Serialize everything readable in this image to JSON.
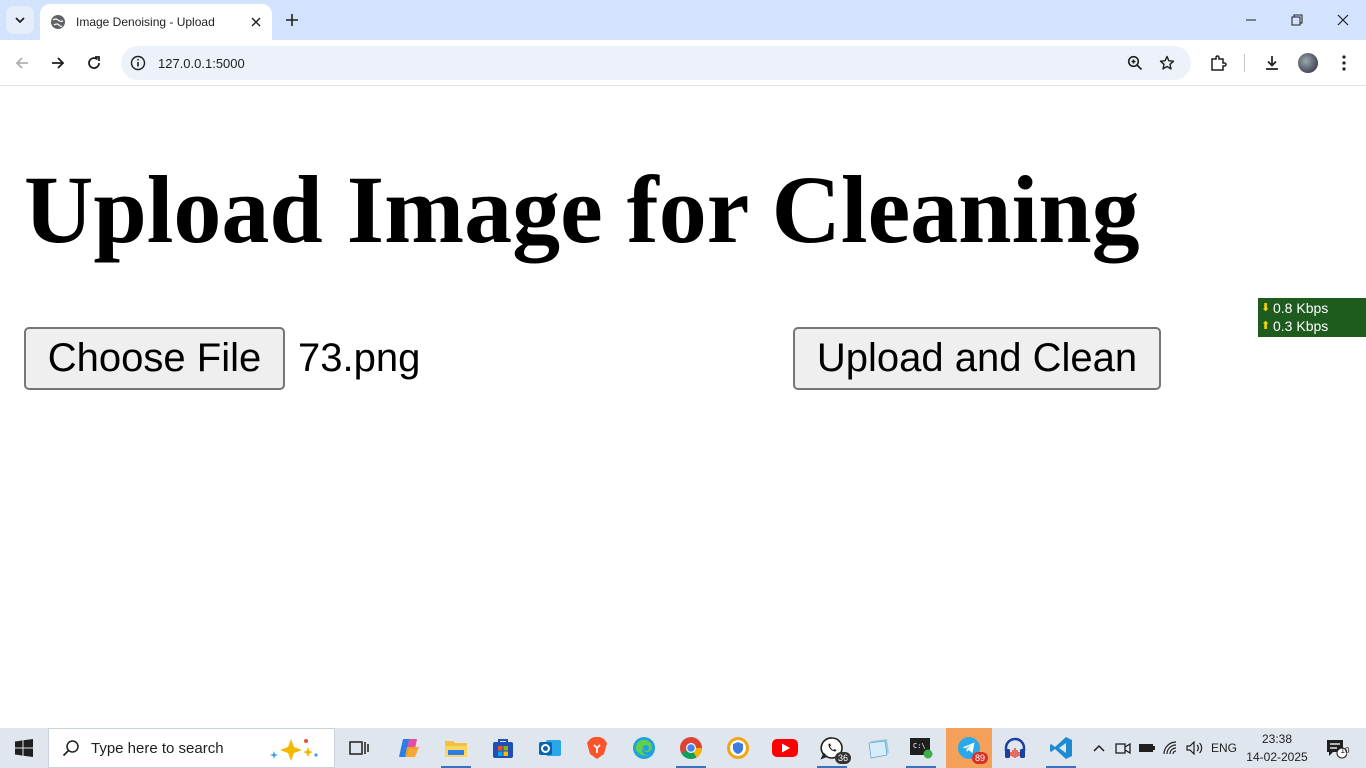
{
  "browser": {
    "tab_title": "Image Denoising - Upload",
    "url": "127.0.0.1:5000"
  },
  "page": {
    "heading": "Upload Image for Cleaning",
    "choose_file_label": "Choose File",
    "selected_file": "73.png",
    "upload_button_label": "Upload and Clean"
  },
  "net_meter": {
    "download": "0.8 Kbps",
    "upload": "0.3 Kbps"
  },
  "taskbar": {
    "search_placeholder": "Type here to search",
    "whatsapp_badge": "36",
    "telegram_badge": "89",
    "language": "ENG",
    "time": "23:38",
    "date": "14-02-2025",
    "notification_count": "10"
  },
  "colors": {
    "tabstrip": "#d3e3fd",
    "omnibox": "#edf2fa",
    "button_bg": "#efefef",
    "button_border": "#767676",
    "net_meter_bg": "#1e5b1e",
    "taskbar": "#dfe6ee"
  }
}
